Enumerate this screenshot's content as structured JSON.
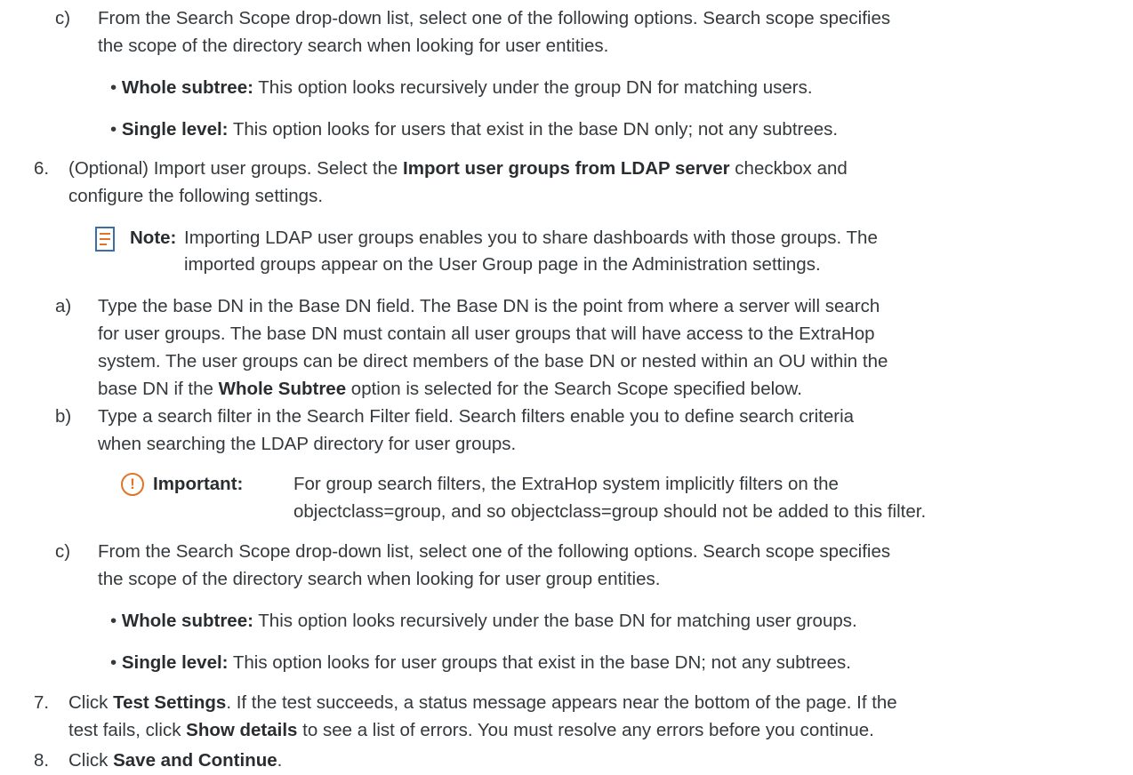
{
  "c1": {
    "label": "c)",
    "line1": "From the Search Scope drop-down list, select one of the following options. Search scope specifies",
    "line2": "the scope of the directory search when looking for user entities.",
    "bullets": [
      {
        "term": "Whole subtree:",
        "text": " This option looks recursively under the group DN for matching users."
      },
      {
        "term": "Single level:",
        "text": " This option looks for users that exist in the base DN only; not any subtrees."
      }
    ]
  },
  "step6": {
    "label": "6.",
    "line1_pre": "(Optional) Import user groups. Select the ",
    "line1_bold": "Import user groups from LDAP server",
    "line1_post": " checkbox and",
    "line2": "configure the following settings."
  },
  "note": {
    "icon": "note-icon",
    "label": "Note:",
    "line1": "Importing LDAP user groups enables you to share dashboards with those groups. The",
    "line2": "imported groups appear on the User Group page in the Administration settings."
  },
  "a": {
    "label": "a)",
    "line1": "Type the base DN in the Base DN field. The Base DN is the point from where a server will search",
    "line2": "for user groups. The base DN must contain all user groups that will have access to the ExtraHop",
    "line3": "system. The user groups can be direct members of the base DN or nested within an OU within the",
    "line4_pre": "base DN if the ",
    "line4_bold": "Whole Subtree",
    "line4_post": " option is selected for the Search Scope specified below."
  },
  "b": {
    "label": "b)",
    "line1": "Type a search filter in the Search Filter field. Search filters enable you to define search criteria",
    "line2": "when searching the LDAP directory for user groups."
  },
  "important": {
    "icon": "important-icon",
    "label": "Important:",
    "line1": "For group search filters, the ExtraHop system implicitly filters on the",
    "line2": "objectclass=group, and so objectclass=group should not be added to this filter."
  },
  "c2": {
    "label": "c)",
    "line1": "From the Search Scope drop-down list, select one of the following options. Search scope specifies",
    "line2": "the scope of the directory search when looking for user group entities.",
    "bullets": [
      {
        "term": "Whole subtree:",
        "text": " This option looks recursively under the base DN for matching user groups."
      },
      {
        "term": "Single level:",
        "text": " This option looks for user groups that exist in the base DN; not any subtrees."
      }
    ]
  },
  "step7": {
    "label": "7.",
    "line1_pre": "Click ",
    "line1_bold1": "Test Settings",
    "line1_post": ". If the test succeeds, a status message appears near the bottom of the page. If the",
    "line2_pre": "test fails, click ",
    "line2_bold": "Show details",
    "line2_post": " to see a list of errors. You must resolve any errors before you continue."
  },
  "step8": {
    "label": "8.",
    "pre": "Click ",
    "bold": "Save and Continue",
    "post": "."
  }
}
